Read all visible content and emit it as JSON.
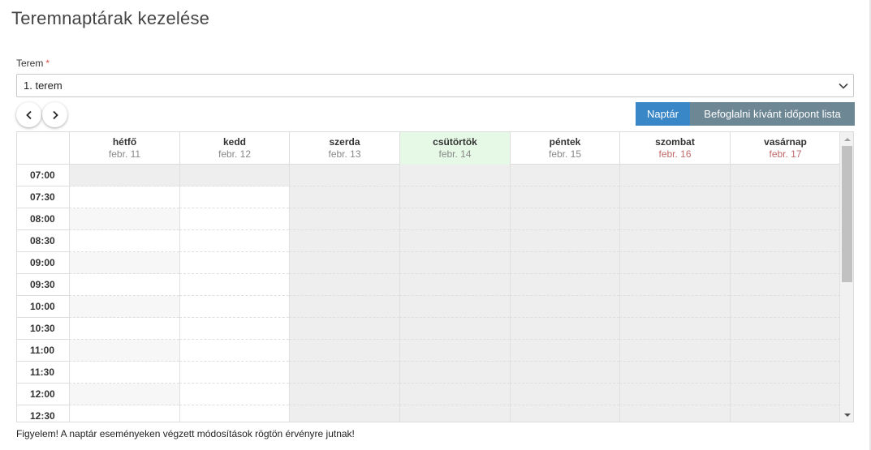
{
  "page": {
    "title": "Teremnaptárak kezelése"
  },
  "room_field": {
    "label": "Terem",
    "required_mark": "*",
    "selected": "1. terem"
  },
  "nav": {
    "prev_icon": "chevron-left-icon",
    "next_icon": "chevron-right-icon"
  },
  "view_buttons": {
    "calendar": "Naptár",
    "list": "Befoglalni kívánt időpont lista"
  },
  "days": [
    {
      "name": "hétfő",
      "date": "febr. 11"
    },
    {
      "name": "kedd",
      "date": "febr. 12"
    },
    {
      "name": "szerda",
      "date": "febr. 13"
    },
    {
      "name": "csütörtök",
      "date": "febr. 14"
    },
    {
      "name": "péntek",
      "date": "febr. 15"
    },
    {
      "name": "szombat",
      "date": "febr. 16"
    },
    {
      "name": "vasárnap",
      "date": "febr. 17"
    }
  ],
  "times": [
    "07:00",
    "07:30",
    "08:00",
    "08:30",
    "09:00",
    "09:30",
    "10:00",
    "10:30",
    "11:00",
    "11:30",
    "12:00",
    "12:30"
  ],
  "footer": {
    "note": "Figyelem! A naptár eseményeken végzett módosítások rögtön érvényre jutnak!"
  },
  "colors": {
    "accent": "#3a87c8",
    "secondary": "#6e8795",
    "today": "#e6f9e6",
    "weekend_date": "#c26a6a",
    "required": "#d9534f"
  }
}
